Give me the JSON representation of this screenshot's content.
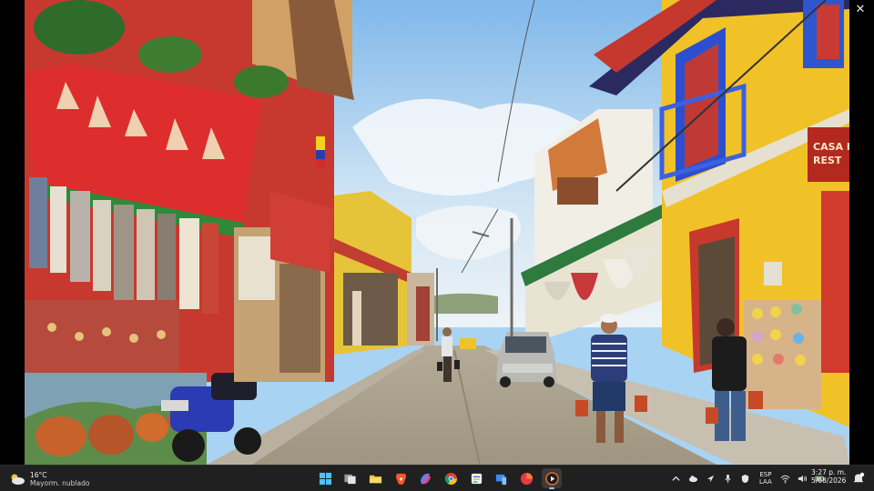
{
  "viewer": {
    "close_glyph": "✕",
    "photo_sign_line1": "CASA N",
    "photo_sign_line2": "REST"
  },
  "taskbar": {
    "weather": {
      "temperature": "16°C",
      "condition": "Mayorm. nublado",
      "icon": "cloud-sun-icon"
    },
    "apps": [
      {
        "name": "start",
        "icon": "windows-start-icon"
      },
      {
        "name": "task-view",
        "icon": "task-view-icon"
      },
      {
        "name": "file-explorer",
        "icon": "folder-icon"
      },
      {
        "name": "brave",
        "icon": "brave-browser-icon"
      },
      {
        "name": "copilot",
        "icon": "copilot-icon"
      },
      {
        "name": "chrome",
        "icon": "chrome-icon"
      },
      {
        "name": "notes",
        "icon": "notes-app-icon"
      },
      {
        "name": "phone-link",
        "icon": "phone-link-icon"
      },
      {
        "name": "photo-app",
        "icon": "red-app-icon"
      },
      {
        "name": "media-player",
        "icon": "media-player-icon",
        "active": true
      }
    ],
    "tray": {
      "language_line1": "ESP",
      "language_line2": "LAA",
      "time": "3:27 p. m.",
      "date": "5/08/2026"
    }
  },
  "colors": {
    "taskbar_bg": "#202020",
    "accent": "#9ac4f8"
  }
}
